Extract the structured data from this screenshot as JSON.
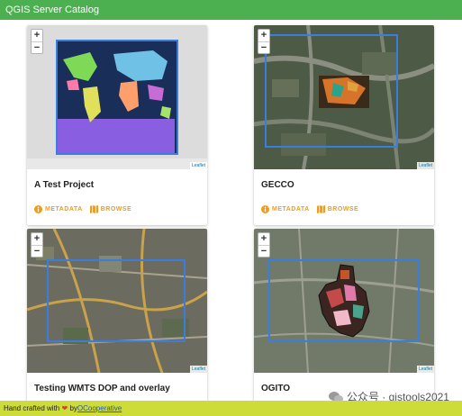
{
  "header": {
    "title": "QGIS Server Catalog"
  },
  "cards": [
    {
      "title": "A Test Project",
      "metadata": "METADATA",
      "browse": "BROWSE",
      "attribution": "Leaflet"
    },
    {
      "title": "GECCO",
      "metadata": "METADATA",
      "browse": "BROWSE",
      "attribution": "Leaflet"
    },
    {
      "title": "Testing WMTS DOP and overlay",
      "attribution": "Leaflet"
    },
    {
      "title": "OGITO",
      "attribution": "Leaflet"
    }
  ],
  "map_controls": {
    "zoom_in": "+",
    "zoom_out": "−"
  },
  "footer": {
    "prefix": "Hand crafted with",
    "by": "by",
    "link": "OCooperative"
  },
  "watermark": {
    "text": "公众号 · gistools2021"
  },
  "colors": {
    "header": "#4caf50",
    "footer": "#cddc39",
    "accent": "#f39c12",
    "bbox": "#3a7de0"
  }
}
